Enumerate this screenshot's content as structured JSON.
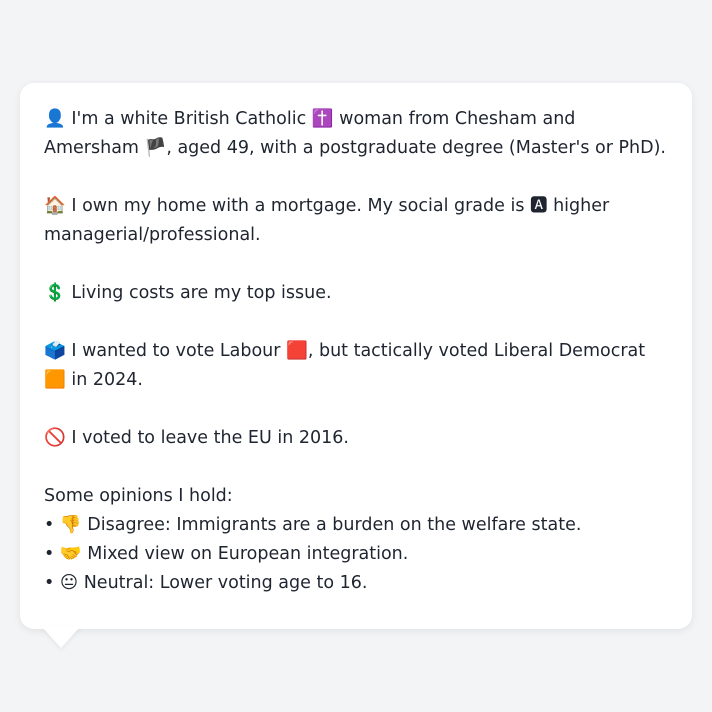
{
  "bio": {
    "identity": {
      "icon": "👤",
      "text_a": " I'm a white British Catholic ",
      "religion_icon": "✝️",
      "text_b": " woman from Chesham and Amersham ",
      "flag_icon": "🏴",
      "text_c": ", aged 49, with a postgraduate degree (Master's or PhD)."
    },
    "home": {
      "icon": "🏠",
      "text_a": " I own my home with a mortgage. My social grade is ",
      "grade_icon": "🅰",
      "text_b": " higher managerial/professional."
    },
    "issue": {
      "icon": "💲",
      "text": " Living costs are my top issue."
    },
    "vote": {
      "icon": "🗳️",
      "text_a": " I wanted to vote Labour ",
      "labour_icon": "🟥",
      "text_b": ", but tactically voted Liberal Democrat ",
      "libdem_icon": "🟧",
      "text_c": " in 2024."
    },
    "brexit": {
      "icon": "🚫",
      "text": " I voted to leave the EU in 2016."
    },
    "opinions": {
      "heading": "Some opinions I hold:",
      "items": [
        {
          "bullet": "•",
          "icon": "👎",
          "text": " Disagree: Immigrants are a burden on the welfare state."
        },
        {
          "bullet": "•",
          "icon": "🤝",
          "text": " Mixed view on European integration."
        },
        {
          "bullet": "•",
          "icon": "😐",
          "text": " Neutral: Lower voting age to 16."
        }
      ]
    }
  }
}
